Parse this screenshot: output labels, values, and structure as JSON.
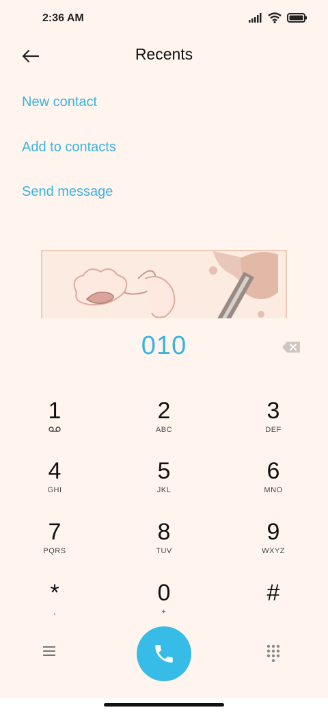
{
  "status_bar": {
    "time": "2:36 AM",
    "icons": [
      "signal-icon",
      "wifi-icon",
      "battery-icon"
    ]
  },
  "header": {
    "back_icon": "back-arrow-icon",
    "title": "Recents"
  },
  "actions": [
    {
      "label": "New contact"
    },
    {
      "label": "Add to contacts"
    },
    {
      "label": "Send message"
    }
  ],
  "dialer": {
    "number": "010",
    "backspace_icon": "backspace-icon",
    "keys": [
      {
        "digit": "1",
        "letters": ""
      },
      {
        "digit": "2",
        "letters": "ABC"
      },
      {
        "digit": "3",
        "letters": "DEF"
      },
      {
        "digit": "4",
        "letters": "GHI"
      },
      {
        "digit": "5",
        "letters": "JKL"
      },
      {
        "digit": "6",
        "letters": "MNO"
      },
      {
        "digit": "7",
        "letters": "PQRS"
      },
      {
        "digit": "8",
        "letters": "TUV"
      },
      {
        "digit": "9",
        "letters": "WXYZ"
      },
      {
        "digit": "*",
        "letters": ","
      },
      {
        "digit": "0",
        "letters": "+"
      },
      {
        "digit": "#",
        "letters": ""
      }
    ]
  },
  "bottom_bar": {
    "menu_icon": "menu-icon",
    "call_icon": "phone-icon",
    "dialpad_icon": "dialpad-icon"
  },
  "colors": {
    "accent": "#3ab3e0",
    "call_button": "#36bce6",
    "background": "#fff5ee"
  }
}
